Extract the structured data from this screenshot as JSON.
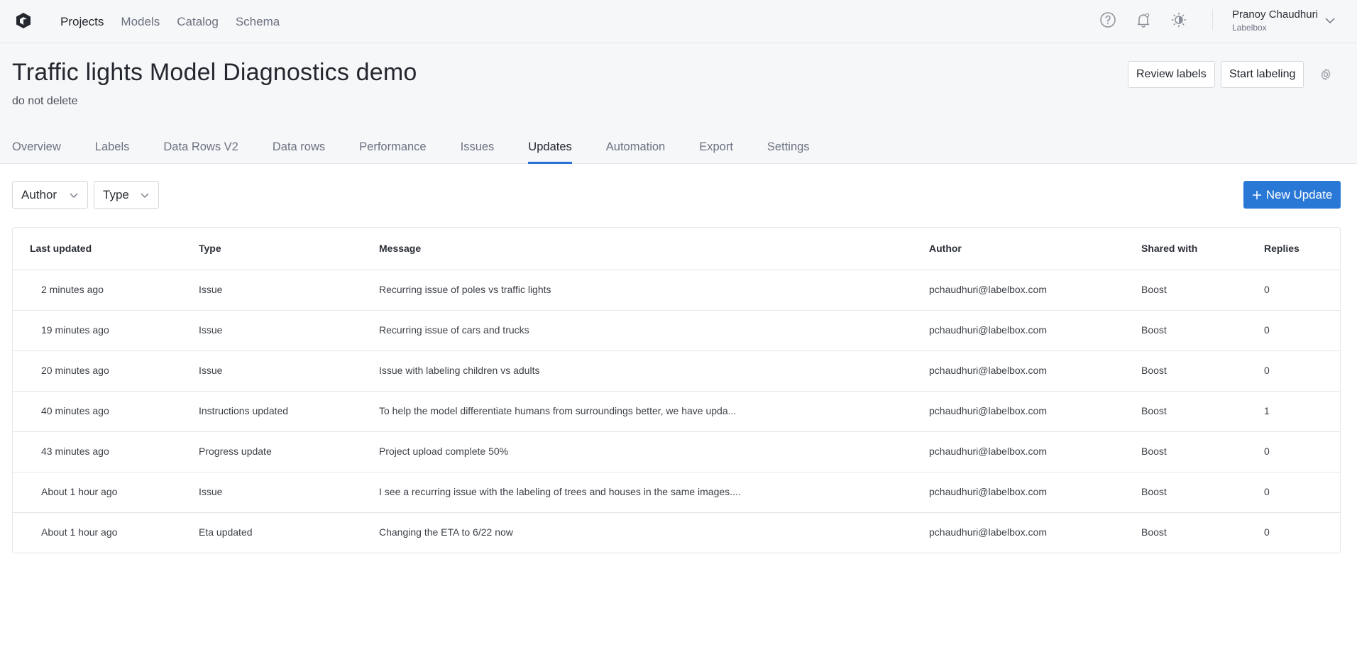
{
  "nav": {
    "items": [
      "Projects",
      "Models",
      "Catalog",
      "Schema"
    ]
  },
  "user": {
    "name": "Pranoy Chaudhuri",
    "org": "Labelbox"
  },
  "icons": [
    "labelbox-logo-icon",
    "help-icon",
    "notification-bell-icon",
    "theme-toggle-icon",
    "chevron-down-icon",
    "settings-gear-icon",
    "plus-icon"
  ],
  "header": {
    "title": "Traffic lights Model Diagnostics demo",
    "subtitle": "do not delete",
    "review_label": "Review labels",
    "start_label": "Start labeling"
  },
  "tabs": [
    "Overview",
    "Labels",
    "Data Rows V2",
    "Data rows",
    "Performance",
    "Issues",
    "Updates",
    "Automation",
    "Export",
    "Settings"
  ],
  "active_tab": "Updates",
  "filters": {
    "author": "Author",
    "type": "Type"
  },
  "new_update_label": "New Update",
  "table": {
    "headers": [
      "Last updated",
      "Type",
      "Message",
      "Author",
      "Shared with",
      "Replies"
    ],
    "rows": [
      {
        "updated": "2 minutes ago",
        "type": "Issue",
        "message": "Recurring issue of poles vs traffic lights",
        "author": "pchaudhuri@labelbox.com",
        "shared": "Boost",
        "replies": "0"
      },
      {
        "updated": "19 minutes ago",
        "type": "Issue",
        "message": "Recurring issue of cars and trucks",
        "author": "pchaudhuri@labelbox.com",
        "shared": "Boost",
        "replies": "0"
      },
      {
        "updated": "20 minutes ago",
        "type": "Issue",
        "message": "Issue with labeling children vs adults",
        "author": "pchaudhuri@labelbox.com",
        "shared": "Boost",
        "replies": "0"
      },
      {
        "updated": "40 minutes ago",
        "type": "Instructions updated",
        "message": "To help the model differentiate humans from surroundings better, we have upda...",
        "author": "pchaudhuri@labelbox.com",
        "shared": "Boost",
        "replies": "1"
      },
      {
        "updated": "43 minutes ago",
        "type": "Progress update",
        "message": "Project upload complete 50%",
        "author": "pchaudhuri@labelbox.com",
        "shared": "Boost",
        "replies": "0"
      },
      {
        "updated": "About 1 hour ago",
        "type": "Issue",
        "message": "I see a recurring issue with the labeling of trees and houses in the same images....",
        "author": "pchaudhuri@labelbox.com",
        "shared": "Boost",
        "replies": "0"
      },
      {
        "updated": "About 1 hour ago",
        "type": "Eta updated",
        "message": "Changing the ETA to 6/22 now",
        "author": "pchaudhuri@labelbox.com",
        "shared": "Boost",
        "replies": "0"
      }
    ]
  },
  "colors": {
    "accent": "#2a78d6",
    "tab_indicator": "#2a6fd6",
    "header_bg": "#f6f7f9"
  }
}
